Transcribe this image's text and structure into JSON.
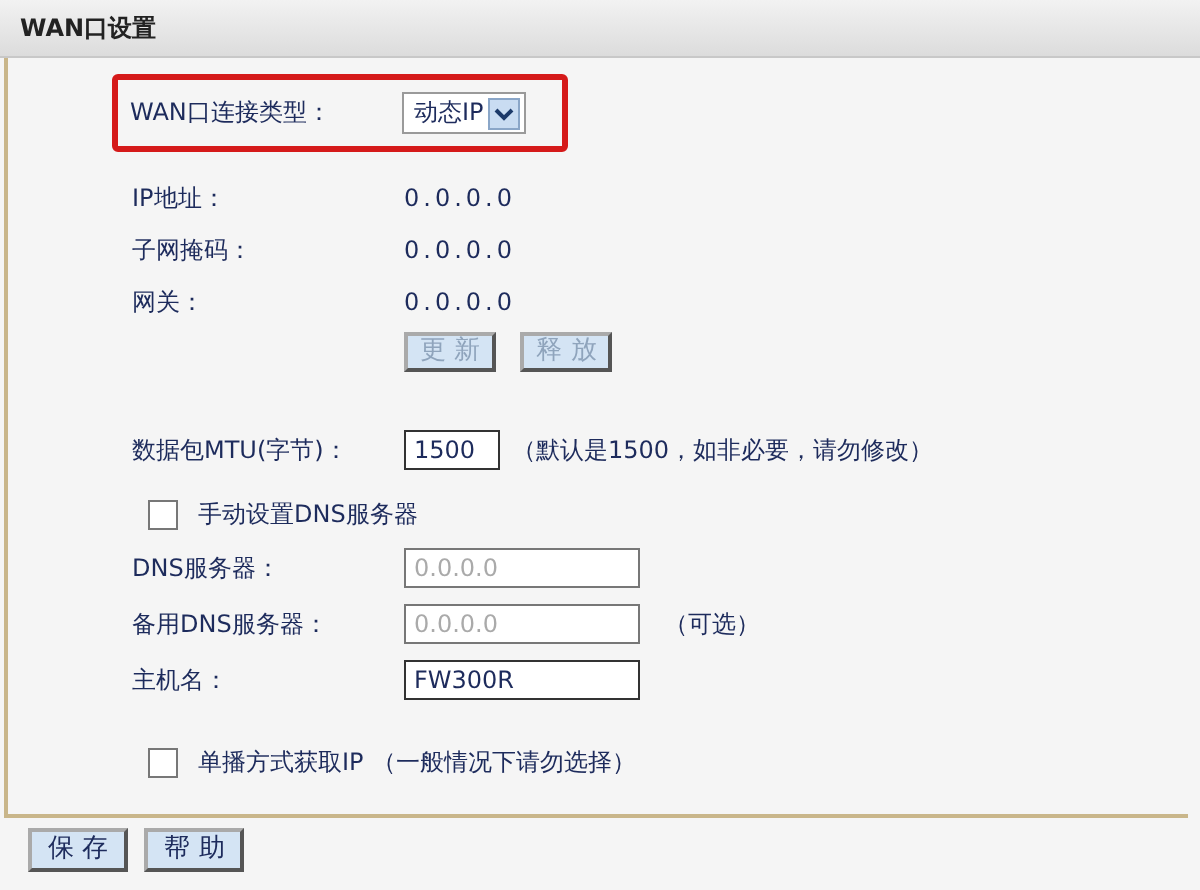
{
  "panel": {
    "title": "WAN口设置"
  },
  "connection_type": {
    "label": "WAN口连接类型：",
    "value": "动态IP",
    "highlighted": true
  },
  "status": [
    {
      "label": "IP地址：",
      "value": "0.0.0.0"
    },
    {
      "label": "子网掩码：",
      "value": "0.0.0.0"
    },
    {
      "label": "网关：",
      "value": "0.0.0.0"
    }
  ],
  "status_buttons": [
    {
      "label": "更 新",
      "disabled": true
    },
    {
      "label": "释 放",
      "disabled": true
    }
  ],
  "mtu": {
    "label": "数据包MTU(字节)：",
    "value": "1500",
    "note": "（默认是1500，如非必要，请勿修改）"
  },
  "manual_dns": {
    "label": "手动设置DNS服务器",
    "checked": false
  },
  "fields": [
    {
      "label": "DNS服务器：",
      "value": "0.0.0.0",
      "disabled": true
    },
    {
      "label": "备用DNS服务器：",
      "value": "0.0.0.0",
      "disabled": true,
      "note": "（可选）"
    },
    {
      "label": "主机名：",
      "value": "FW300R",
      "disabled": false
    }
  ],
  "unicast": {
    "label": "单播方式获取IP",
    "note": "（一般情况下请勿选择）",
    "checked": false
  },
  "footer_buttons": [
    {
      "label": "保 存"
    },
    {
      "label": "帮 助"
    }
  ]
}
